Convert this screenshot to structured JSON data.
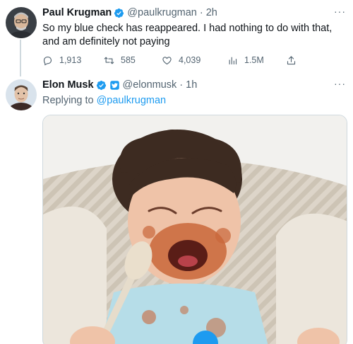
{
  "tweets": [
    {
      "author": {
        "name": "Paul Krugman",
        "handle": "@paulkrugman",
        "verified": true
      },
      "time": "2h",
      "text": "So my blue check has reappeared. I had nothing to do with that, and am definitely not paying",
      "stats": {
        "replies": "1,913",
        "retweets": "585",
        "likes": "4,039",
        "views": "1.5M"
      },
      "more_icon": "more-horizontal-icon"
    },
    {
      "author": {
        "name": "Elon Musk",
        "handle": "@elonmusk",
        "verified": true,
        "affiliate_badge": "twitter-square-icon"
      },
      "time": "1h",
      "replying_prefix": "Replying to ",
      "replying_to": "@paulkrugman",
      "media": {
        "type": "image",
        "subject": "crying toddler with food on face, holding a spoon"
      },
      "more_icon": "more-horizontal-icon"
    }
  ],
  "separator": "·",
  "more_label": "···",
  "colors": {
    "accent": "#1d9bf0",
    "text": "#0f1419",
    "secondary": "#536471",
    "gold": "#f4c400"
  }
}
